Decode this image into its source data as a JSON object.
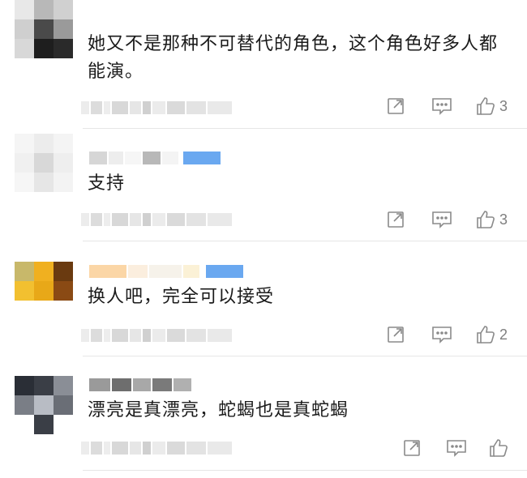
{
  "comments": [
    {
      "text": "她又不是那种不可替代的角色，这个角色好多人都能演。",
      "likes": "3"
    },
    {
      "text": "支持",
      "likes": "3"
    },
    {
      "text": "换人吧，完全可以接受",
      "likes": "2"
    },
    {
      "text": "漂亮是真漂亮，蛇蝎也是真蛇蝎",
      "likes": ""
    }
  ],
  "icons": {
    "share": "share-icon",
    "comment": "comment-icon",
    "like": "thumbs-up-icon"
  },
  "colors": {
    "text": "#1a1a1a",
    "icon": "#8a8a8a",
    "divider": "#e6e6e6",
    "badge_blue": "#6aa8f0"
  }
}
